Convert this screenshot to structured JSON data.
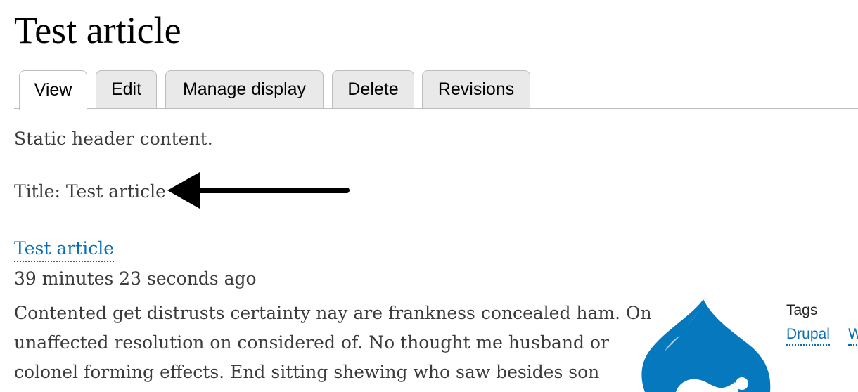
{
  "page": {
    "title": "Test article"
  },
  "tabs": [
    {
      "label": "View",
      "active": true
    },
    {
      "label": "Edit",
      "active": false
    },
    {
      "label": "Manage display",
      "active": false
    },
    {
      "label": "Delete",
      "active": false
    },
    {
      "label": "Revisions",
      "active": false
    }
  ],
  "view": {
    "header_text": "Static header content.",
    "title_field": "Title: Test article"
  },
  "article": {
    "link_text": "Test article",
    "timestamp": "39 minutes 23 seconds ago",
    "body_lines": [
      "Contented get distrusts certainty nay are frankness concealed ham. On",
      "unaffected resolution on considered of. No thought me husband or",
      "colonel forming effects. End sitting shewing who saw besides son"
    ]
  },
  "tags": {
    "label": "Tags",
    "items": [
      "Drupal",
      "W"
    ]
  },
  "colors": {
    "link": "#0a6eb4",
    "tab_bg": "#e9e9e9",
    "drop_blue": "#0678be"
  },
  "icons": {
    "annotation": "arrow-left-icon",
    "logo": "drupal-drop-logo"
  }
}
